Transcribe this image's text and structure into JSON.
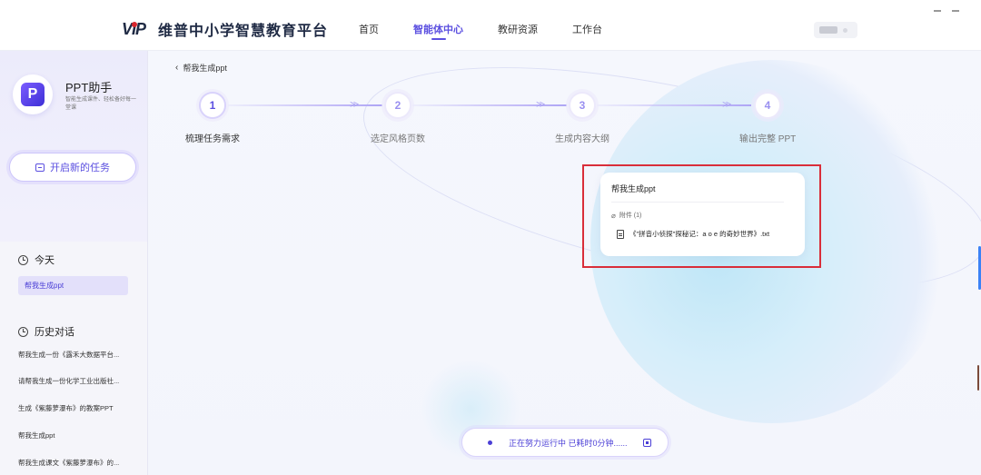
{
  "header": {
    "logo_mark": "VIP",
    "logo_text": "维普中小学智慧教育平台",
    "nav": [
      {
        "label": "首页"
      },
      {
        "label": "智能体中心",
        "active": true
      },
      {
        "label": "教研资源"
      },
      {
        "label": "工作台"
      }
    ]
  },
  "sidebar": {
    "app_name": "PPT助手",
    "app_desc": "智能生成课件、轻松备好每一堂课",
    "new_task_label": "开启新的任务",
    "today_title": "今天",
    "today_items": [
      "帮我生成ppt"
    ],
    "history_title": "历史对话",
    "history_items": [
      "帮我生成一份《露禾大数据平台...",
      "请帮我生成一份化学工业出版社...",
      "生成《紫藤萝瀑布》的教案PPT",
      "帮我生成ppt",
      "帮我生成课文《紫藤萝瀑布》的..."
    ]
  },
  "main": {
    "back_label": "帮我生成ppt",
    "steps": [
      {
        "num": "1",
        "label": "梳理任务需求"
      },
      {
        "num": "2",
        "label": "选定风格页数"
      },
      {
        "num": "3",
        "label": "生成内容大纲"
      },
      {
        "num": "4",
        "label": "输出完整 PPT"
      }
    ],
    "message": {
      "title": "帮我生成ppt",
      "attach_label": "附件 (1)",
      "file_name": "《\"拼音小侦探\"探秘记：a o e 的奇妙世界》.txt"
    },
    "status": {
      "text": "正在努力运行中   已耗时0分钟......"
    }
  },
  "colors": {
    "accent": "#5b4fe0",
    "highlight": "#d92e3a"
  }
}
